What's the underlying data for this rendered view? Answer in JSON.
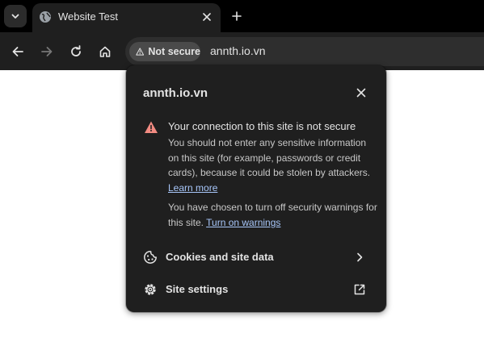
{
  "browser": {
    "tab": {
      "title": "Website Test",
      "favicon": "globe-icon"
    },
    "icons": {
      "tab_search": "chevron-down-icon",
      "tab_close": "close-icon",
      "new_tab": "plus-icon",
      "back": "arrow-left-icon",
      "forward": "arrow-right-icon",
      "reload": "reload-icon",
      "home": "home-icon"
    },
    "omnibox": {
      "security_chip_label": "Not secure",
      "security_chip_icon": "warning-triangle-icon",
      "url": "annth.io.vn"
    }
  },
  "site_info_popup": {
    "title": "annth.io.vn",
    "close_icon": "close-icon",
    "warning": {
      "icon": "warning-triangle-icon",
      "icon_color": "#f28b82",
      "heading": "Your connection to this site is not secure",
      "body": "You should not enter any sensitive information on this site (for example, passwords or credit cards), because it could be stolen by attackers.",
      "learn_more": "Learn more",
      "disabled_warnings_text": "You have chosen to turn off security warnings for this site.",
      "turn_on_warnings": "Turn on warnings"
    },
    "rows": [
      {
        "label": "Cookies and site data",
        "icon": "cookie-icon",
        "end_icon": "chevron-right-icon"
      },
      {
        "label": "Site settings",
        "icon": "gear-icon",
        "end_icon": "open-external-icon"
      }
    ]
  },
  "colors": {
    "tabstrip_bg": "#000000",
    "toolbar_bg": "#1f1f1f",
    "popup_bg": "#1f1f1f",
    "link": "#a8c7fa",
    "page_bg": "#ffffff"
  }
}
